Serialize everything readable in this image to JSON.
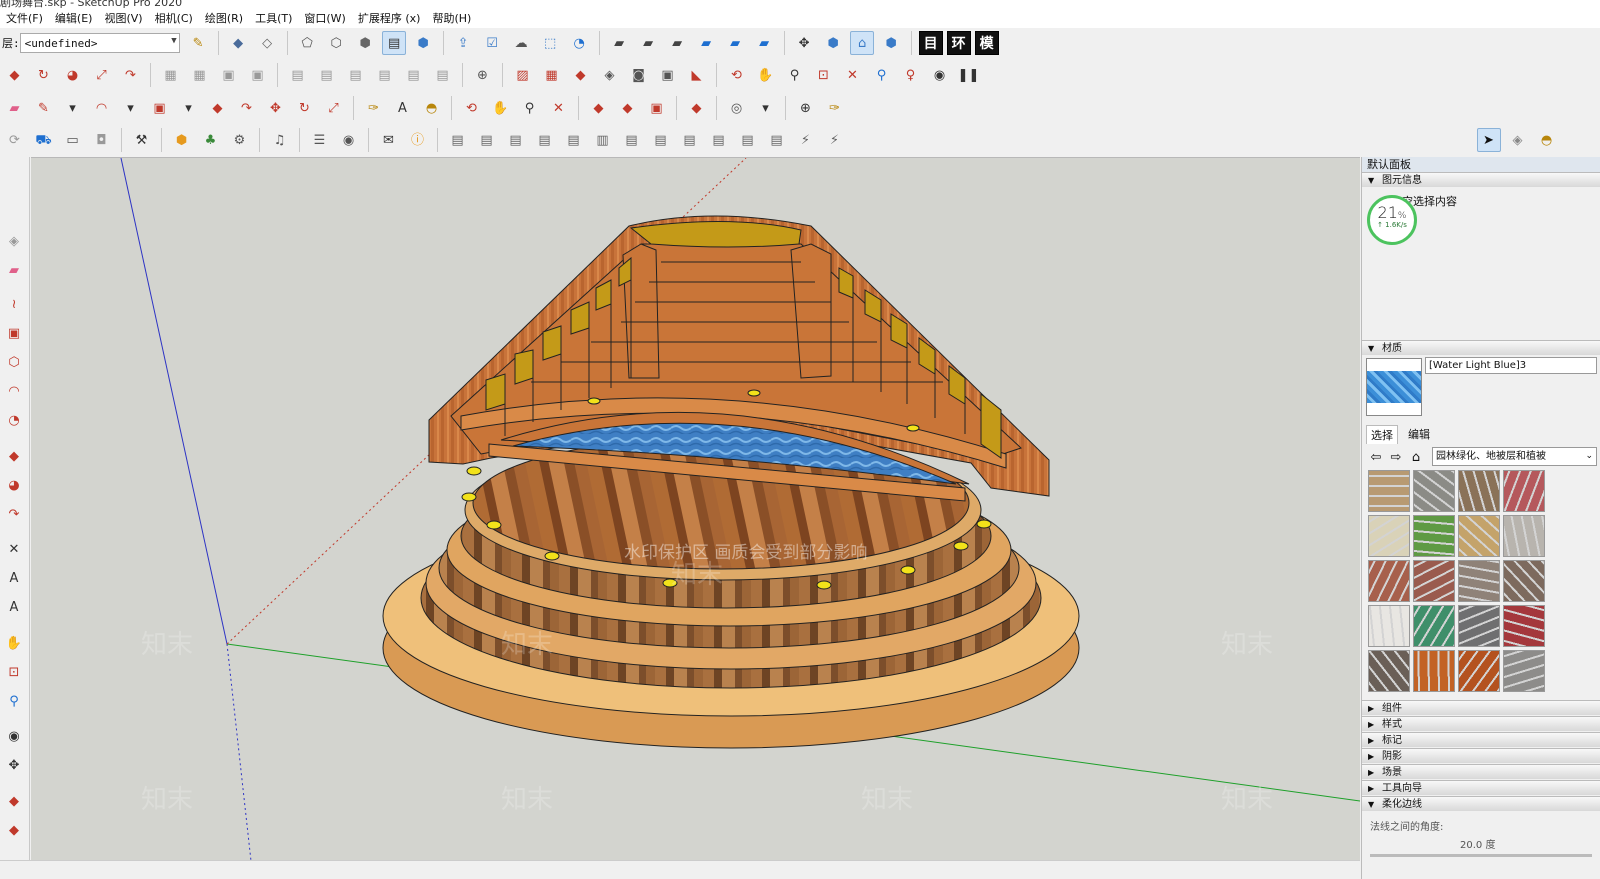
{
  "window": {
    "title": "剧场舞台.skp - SketchUp Pro 2020"
  },
  "menu": [
    "文件(F)",
    "编辑(E)",
    "视图(V)",
    "相机(C)",
    "绘图(R)",
    "工具(T)",
    "窗口(W)",
    "扩展程序 (x)",
    "帮助(H)"
  ],
  "layer": {
    "label": "层:",
    "value": "<undefined>"
  },
  "quick_words": [
    "目",
    "环",
    "模"
  ],
  "tray": {
    "title": "默认面板",
    "entity_info": {
      "header": "图元信息",
      "content": "空选择内容"
    },
    "speed": {
      "percent": "21",
      "unit": "%",
      "rate": "↑ 1.6K/s"
    },
    "materials": {
      "header": "材质",
      "name": "[Water Light Blue]3",
      "tabs": [
        "选择",
        "编辑"
      ],
      "library": "园林绿化、地被层和植被",
      "swatch_colors": [
        "#b89a72",
        "#8b8b86",
        "#8a7258",
        "#b5585c",
        "#d9d2b8",
        "#5f9a44",
        "#c4a36a",
        "#b8b4ae",
        "#a7604c",
        "#9a5b4e",
        "#8f8278",
        "#7d6a5e",
        "#e8e6e2",
        "#3f8f6a",
        "#6f6f70",
        "#a4383c",
        "#6a5f57",
        "#c26225",
        "#b4521f",
        "#8d8c8a"
      ]
    },
    "panels": [
      "组件",
      "样式",
      "标记",
      "阴影",
      "场景",
      "工具向导",
      "柔化边线"
    ],
    "soften": {
      "label": "法线之间的角度:",
      "value": "20.0  度"
    }
  },
  "viewport": {
    "watermark": "水印保护区 画质会受到部分影响",
    "watermark_tile": "知末"
  }
}
